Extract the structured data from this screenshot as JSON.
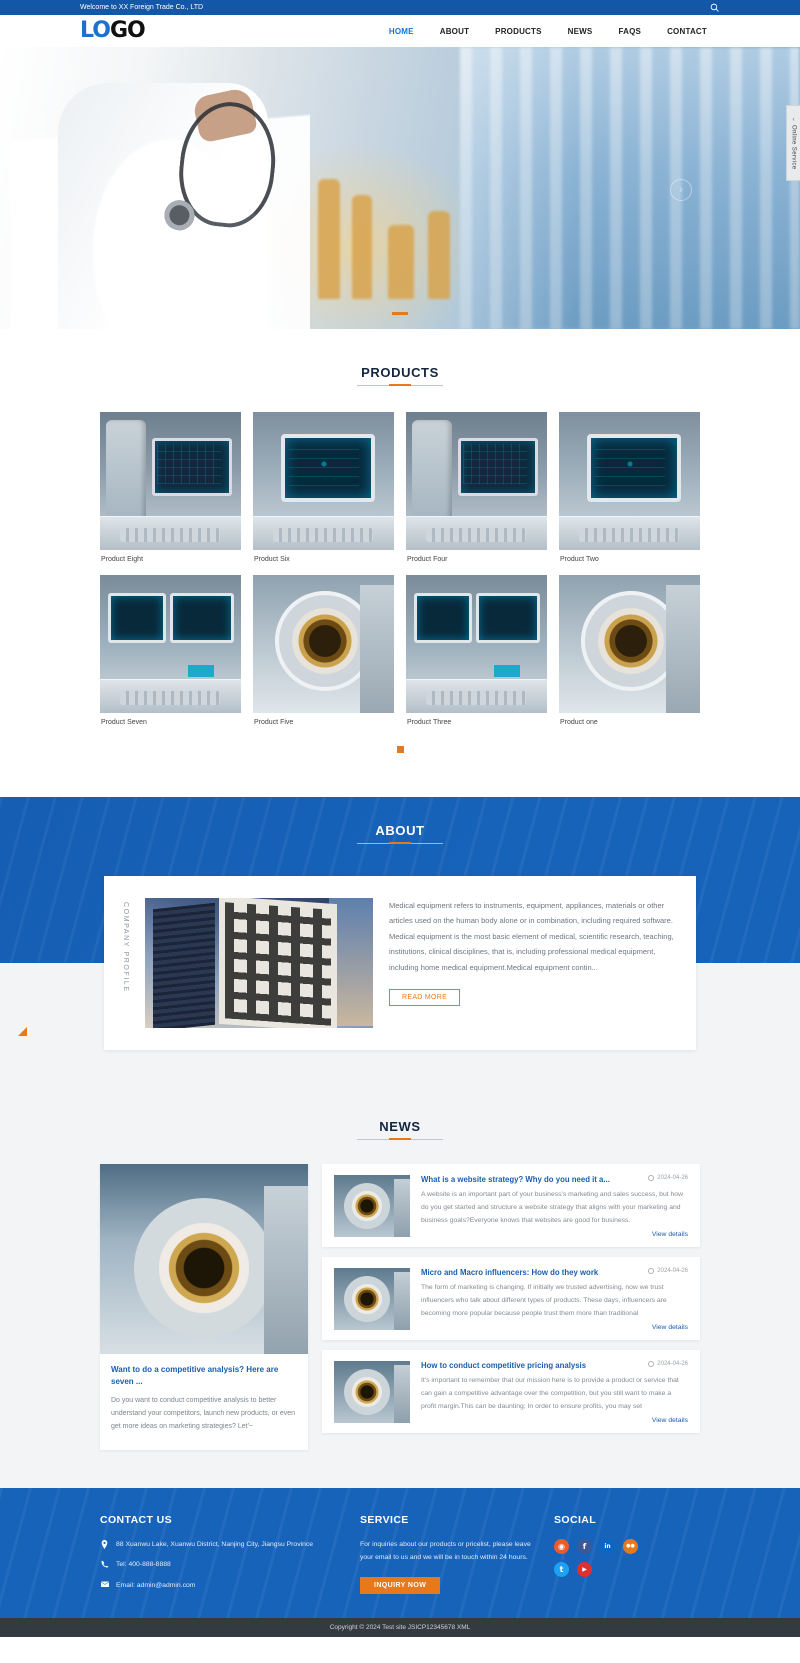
{
  "topbar": {
    "welcome": "Welcome to XX Foreign Trade Co., LTD",
    "search_icon": "search-icon"
  },
  "header": {
    "logo_part1": "LO",
    "logo_part2": "GO",
    "nav": [
      {
        "label": "HOME",
        "active": true
      },
      {
        "label": "ABOUT",
        "active": false
      },
      {
        "label": "PRODUCTS",
        "active": false
      },
      {
        "label": "NEWS",
        "active": false
      },
      {
        "label": "FAQS",
        "active": false
      },
      {
        "label": "CONTACT",
        "active": false
      }
    ]
  },
  "hero": {
    "prev_icon": "chevron-left-icon",
    "next_icon": "chevron-right-icon",
    "slides": 1
  },
  "online_service": {
    "label": "Online Service",
    "arrow_icon": "chevron-left-icon"
  },
  "products": {
    "title": "PRODUCTS",
    "items": [
      {
        "name": "Product Eight"
      },
      {
        "name": "Product Six"
      },
      {
        "name": "Product Four"
      },
      {
        "name": "Product Two"
      },
      {
        "name": "Product Seven"
      },
      {
        "name": "Product Five"
      },
      {
        "name": "Product Three"
      },
      {
        "name": "Product one"
      }
    ]
  },
  "about": {
    "title": "ABOUT",
    "vertical_label": "COMPANY PROFILE",
    "paragraph": "Medical equipment refers to instruments, equipment, appliances, materials or other articles used on the human body alone or in combination, including required software. Medical equipment is the most basic element of medical, scientific research, teaching, institutions, clinical disciplines, that is, including professional medical equipment, including home medical equipment.Medical equipment contin...",
    "read_more": "READ MORE"
  },
  "news": {
    "title": "NEWS",
    "feature": {
      "title": "Want to do a competitive analysis? Here are seven ...",
      "desc": "Do you want to conduct competitive analysis to better understand your competitors, launch new products, or even get more ideas on marketing strategies? Let'~"
    },
    "items": [
      {
        "title": "What is a website strategy? Why do you need it a...",
        "date": "2024-04-26",
        "desc": "A website is an important part of your business's marketing and sales success, but how do you get started and structure a website strategy that aligns with your marketing and business goals?Everyone knows that websites are good for business.",
        "more": "View details"
      },
      {
        "title": "Micro and Macro influencers: How do they work",
        "date": "2024-04-26",
        "desc": "The form of marketing is changing. If initially we trusted advertising, now we trust influencers who talk about different types of products. These days, influencers are becoming more popular because people trust them more than traditional",
        "more": "View details"
      },
      {
        "title": "How to conduct competitive pricing analysis",
        "date": "2024-04-26",
        "desc": "It's important to remember that our mission here is to provide a product or service that can gain a competitive advantage over the competition, but you still want to make a profit margin.This can be daunting; In order to ensure profits, you may set",
        "more": "View details"
      }
    ]
  },
  "footer": {
    "contact": {
      "title": "CONTACT US",
      "address_icon": "location-pin-icon",
      "address": "88 Xuanwu Lake, Xuanwu District, Nanjing City, Jiangsu Province",
      "phone_icon": "phone-icon",
      "phone": "Tel: 400-888-8888",
      "email_icon": "envelope-icon",
      "email": "Email: admin@admin.com"
    },
    "service": {
      "title": "SERVICE",
      "text": "For inquiries about our products or pricelist, please leave your email to us and we will be in touch within 24 hours.",
      "button": "INQUIRY NOW"
    },
    "social": {
      "title": "SOCIAL",
      "icons": [
        {
          "name": "rss-icon",
          "glyph": "◉",
          "color": "#ef5a2a"
        },
        {
          "name": "facebook-icon",
          "glyph": "f",
          "color": "#3b5998"
        },
        {
          "name": "linkedin-icon",
          "glyph": "in",
          "color": "#0a66c2"
        },
        {
          "name": "flickr-icon",
          "glyph": "●●",
          "color": "#e8791a"
        },
        {
          "name": "twitter-icon",
          "glyph": "t",
          "color": "#1da1f2"
        },
        {
          "name": "youtube-icon",
          "glyph": "▶",
          "color": "#e02f2f"
        }
      ]
    },
    "copyright": "Copyright © 2024 Test site JSICP12345678 XML"
  },
  "colors": {
    "brand_blue": "#1763ba",
    "topbar_blue": "#1257a8",
    "accent_orange": "#e8791a",
    "link_blue": "#1a5fae",
    "footer_bar": "#333a40"
  }
}
